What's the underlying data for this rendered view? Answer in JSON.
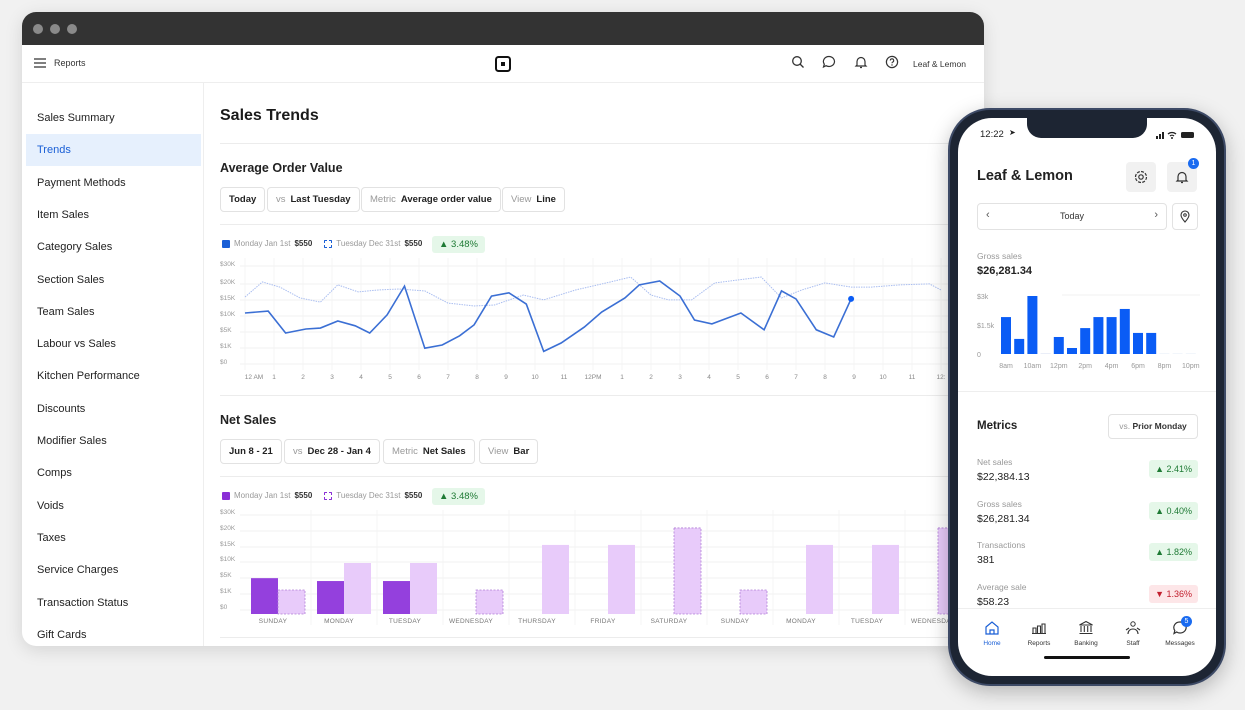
{
  "desktop": {
    "header": {
      "menu_label": "Reports",
      "account": "Leaf & Lemon"
    },
    "sidebar": {
      "items": [
        {
          "label": "Sales Summary"
        },
        {
          "label": "Trends",
          "active": true
        },
        {
          "label": "Payment Methods"
        },
        {
          "label": "Item Sales"
        },
        {
          "label": "Category Sales"
        },
        {
          "label": "Section Sales"
        },
        {
          "label": "Team Sales"
        },
        {
          "label": "Labour vs Sales"
        },
        {
          "label": "Kitchen Performance"
        },
        {
          "label": "Discounts"
        },
        {
          "label": "Modifier Sales"
        },
        {
          "label": "Comps"
        },
        {
          "label": "Voids"
        },
        {
          "label": "Taxes"
        },
        {
          "label": "Service Charges"
        },
        {
          "label": "Transaction Status"
        },
        {
          "label": "Gift Cards"
        }
      ]
    },
    "page_title": "Sales Trends",
    "aov": {
      "title": "Average Order Value",
      "filters": {
        "date": "Today",
        "vs_key": "vs",
        "vs": "Last Tuesday",
        "metric_key": "Metric",
        "metric": "Average order value",
        "view_key": "View",
        "view": "Line"
      },
      "legend": {
        "primary": "Monday Jan 1st",
        "primary_value": "$550",
        "compare": "Tuesday Dec 31st",
        "compare_value": "$550",
        "change": "3.48%"
      }
    },
    "net": {
      "title": "Net Sales",
      "filters": {
        "date": "Jun 8 - 21",
        "vs_key": "vs",
        "vs": "Dec 28 - Jan 4",
        "metric_key": "Metric",
        "metric": "Net Sales",
        "view_key": "View",
        "view": "Bar"
      },
      "legend": {
        "primary": "Monday Jan 1st",
        "primary_value": "$550",
        "compare": "Tuesday Dec 31st",
        "compare_value": "$550",
        "change": "3.48%"
      }
    }
  },
  "chart_data": [
    {
      "type": "line",
      "y_ticks": [
        {
          "label": "$30K",
          "v": 30
        },
        {
          "label": "$20K",
          "v": 20
        },
        {
          "label": "$15K",
          "v": 15
        },
        {
          "label": "$10K",
          "v": 10
        },
        {
          "label": "$5K",
          "v": 5
        },
        {
          "label": "$1K",
          "v": 1
        },
        {
          "label": "$0",
          "v": 0
        }
      ],
      "x_ticks": [
        "12 AM",
        "1",
        "2",
        "3",
        "4",
        "5",
        "6",
        "7",
        "8",
        "9",
        "10",
        "11",
        "12PM",
        "1",
        "2",
        "3",
        "4",
        "5",
        "6",
        "7",
        "8",
        "9",
        "10",
        "11",
        "12:"
      ],
      "grid": true,
      "colors": {
        "primary": "#3b6fd4",
        "compare": "#a9bdf0"
      },
      "series": [
        {
          "name": "Monday Jan 1st",
          "x": [
            0,
            0.8,
            1.4,
            2.1,
            2.6,
            3.2,
            3.8,
            4.3,
            4.9,
            5.5,
            6.2,
            6.8,
            7.4,
            7.9,
            8.5,
            9.1,
            9.7,
            10.3,
            10.9,
            11.7,
            12.3,
            13.1,
            13.6,
            14.3,
            15,
            15.5,
            16.1,
            17.1,
            17.9,
            18.5,
            19,
            19.7,
            20.3,
            20.9
          ],
          "y": [
            10,
            10.6,
            4,
            5,
            5.3,
            7.5,
            6,
            4,
            9.4,
            18.4,
            0.8,
            1,
            3.3,
            6.3,
            15.3,
            16.3,
            12.8,
            0.6,
            1.5,
            5.6,
            10.3,
            14.7,
            18.8,
            20,
            15.3,
            7.8,
            6.6,
            10,
            4.8,
            16.9,
            14.4,
            4.8,
            3,
            14.4
          ]
        },
        {
          "name": "Tuesday Dec 31st",
          "x": [
            0,
            0.6,
            1.2,
            1.9,
            2.6,
            3.2,
            3.9,
            4.6,
            5.3,
            6.2,
            7,
            7.9,
            8.6,
            9.6,
            10.3,
            11.4,
            12.6,
            13.3,
            14,
            14.6,
            15.4,
            16.2,
            17.8,
            18.5,
            19.2,
            20,
            20.9,
            21.6,
            22.6,
            23.6,
            24
          ],
          "y": [
            15,
            19.7,
            18.1,
            14.7,
            13.4,
            18.8,
            16.6,
            17.2,
            17.5,
            16.9,
            13.1,
            12.2,
            12.5,
            15.6,
            14.1,
            17.2,
            19.7,
            22.2,
            15.6,
            14.1,
            14.1,
            19.4,
            22.2,
            14.7,
            17.2,
            19.4,
            18.1,
            18.1,
            18.8,
            19.1,
            17.2
          ]
        }
      ]
    },
    {
      "type": "bar",
      "y_ticks": [
        {
          "label": "$30K",
          "v": 30
        },
        {
          "label": "$20K",
          "v": 20
        },
        {
          "label": "$15K",
          "v": 15
        },
        {
          "label": "$10K",
          "v": 10
        },
        {
          "label": "$5K",
          "v": 5
        },
        {
          "label": "$1K",
          "v": 1
        },
        {
          "label": "$0",
          "v": 0
        }
      ],
      "categories": [
        "SUNDAY",
        "MONDAY",
        "TUESDAY",
        "WEDNESDAY",
        "THURSDAY",
        "FRIDAY",
        "SATURDAY",
        "SUNDAY",
        "MONDAY",
        "TUESDAY",
        "WEDNESDAY"
      ],
      "colors": {
        "primary": "#9440dd",
        "compare": "#e8cbfa",
        "compare_border": "#b07fd6"
      },
      "series": [
        {
          "name": "Monday Jan 1st",
          "values": [
            6.2,
            5.3,
            5.3,
            null,
            null,
            null,
            null,
            null,
            null,
            null,
            null
          ]
        },
        {
          "name": "Tuesday Dec 31st",
          "values": [
            3,
            11,
            11,
            3,
            16.9,
            16.9,
            24.4,
            3,
            16.9,
            16.9,
            24.4
          ],
          "dashed": [
            true,
            false,
            false,
            true,
            false,
            false,
            true,
            true,
            false,
            false,
            true
          ]
        }
      ]
    },
    {
      "type": "bar",
      "y_ticks": [
        {
          "label": "$3k",
          "v": 3
        },
        {
          "label": "$1.5k",
          "v": 1.5
        },
        {
          "label": "0",
          "v": 0
        }
      ],
      "x_ticks": [
        "8am",
        "10am",
        "12pm",
        "2pm",
        "4pm",
        "6pm",
        "8pm",
        "10pm"
      ],
      "categories": [
        "8am",
        "9am",
        "10am",
        "11am",
        "12pm",
        "1pm",
        "2pm",
        "3pm",
        "4pm",
        "5pm",
        "6pm",
        "7pm",
        "8pm",
        "9pm",
        "10pm"
      ],
      "values": [
        1.91,
        0.78,
        3,
        0.05,
        0.88,
        0.31,
        1.34,
        1.91,
        1.91,
        2.33,
        1.09,
        1.09,
        0,
        0,
        0
      ],
      "colors": {
        "bar": "#0a5cf5"
      }
    }
  ],
  "phone": {
    "time": "12:22",
    "title": "Leaf & Lemon",
    "bell_badge": "1",
    "date": "Today",
    "gross_label": "Gross sales",
    "gross_value": "$26,281.34",
    "metrics_title": "Metrics",
    "compare_key": "vs.",
    "compare_value": "Prior Monday",
    "metrics": [
      {
        "label": "Net sales",
        "value": "$22,384.13",
        "change": "▲ 2.41%",
        "dir": "up"
      },
      {
        "label": "Gross sales",
        "value": "$26,281.34",
        "change": "▲ 0.40%",
        "dir": "up"
      },
      {
        "label": "Transactions",
        "value": "381",
        "change": "▲ 1.82%",
        "dir": "up"
      },
      {
        "label": "Average sale",
        "value": "$58.23",
        "change": "▼ 1.36%",
        "dir": "down"
      }
    ],
    "tabs": [
      {
        "label": "Home",
        "icon": "home-icon"
      },
      {
        "label": "Reports",
        "icon": "reports-icon"
      },
      {
        "label": "Banking",
        "icon": "bank-icon"
      },
      {
        "label": "Staff",
        "icon": "staff-icon"
      },
      {
        "label": "Messages",
        "icon": "messages-icon"
      }
    ],
    "messages_badge": "5"
  }
}
